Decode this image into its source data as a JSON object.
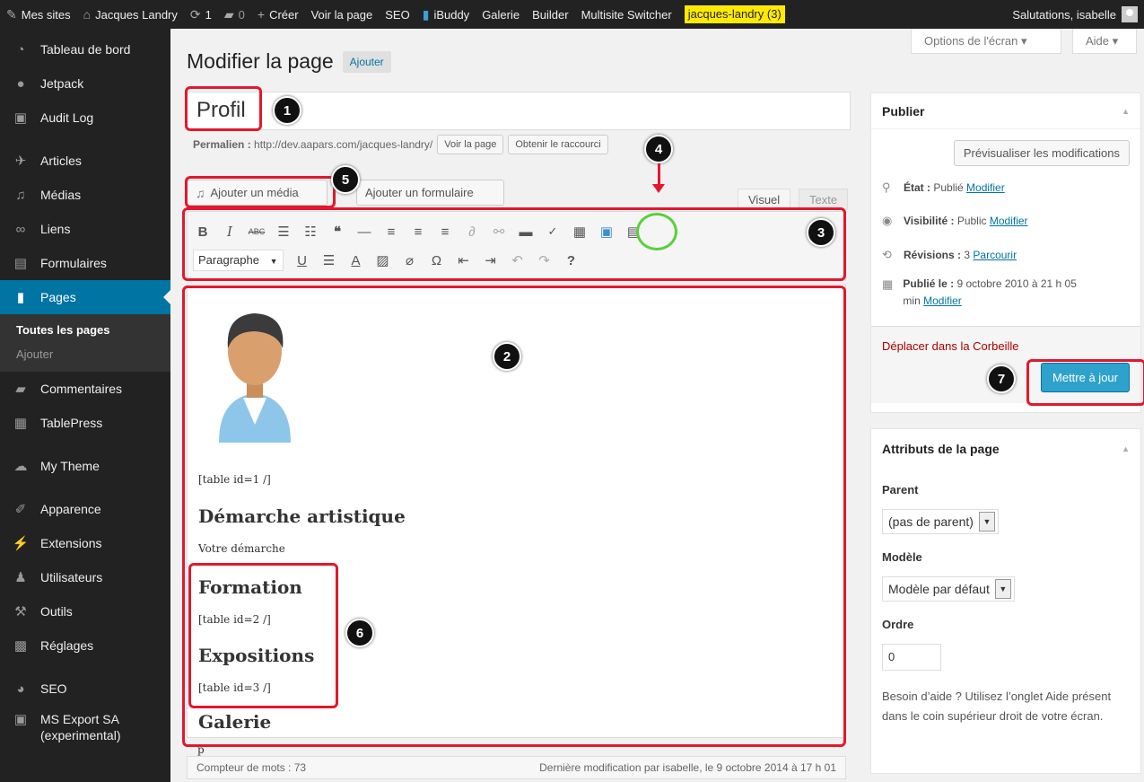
{
  "adminbar": {
    "items": [
      {
        "icon": "wp-logo-icon",
        "glyph": "✎",
        "label": "Mes sites"
      },
      {
        "icon": "home-icon",
        "glyph": "⌂",
        "label": "Jacques Landry"
      },
      {
        "icon": "updates-icon",
        "glyph": "⟳",
        "label": "1"
      },
      {
        "icon": "comments-icon",
        "glyph": "▰",
        "label": "0"
      },
      {
        "icon": "plus-icon",
        "glyph": "+",
        "label": "Créer"
      },
      {
        "icon": "",
        "glyph": "",
        "label": "Voir la page"
      },
      {
        "icon": "",
        "glyph": "",
        "label": "SEO"
      },
      {
        "icon": "ibuddy-icon",
        "glyph": "▮",
        "label": "iBuddy"
      },
      {
        "icon": "",
        "glyph": "",
        "label": "Galerie"
      },
      {
        "icon": "",
        "glyph": "",
        "label": "Builder"
      },
      {
        "icon": "",
        "glyph": "",
        "label": "Multisite Switcher"
      }
    ],
    "highlight": "jacques-landry (3)",
    "greeting": "Salutations, isabelle"
  },
  "sidebar": {
    "items": [
      {
        "icon": "dashboard-icon",
        "glyph": "◔",
        "label": "Tableau de bord"
      },
      {
        "icon": "jetpack-icon",
        "glyph": "●",
        "label": "Jetpack"
      },
      {
        "icon": "audit-log-icon",
        "glyph": "▣",
        "label": "Audit Log"
      },
      {
        "icon": "articles-icon",
        "glyph": "✈",
        "label": "Articles"
      },
      {
        "icon": "media-icon",
        "glyph": "♫",
        "label": "Médias"
      },
      {
        "icon": "links-icon",
        "glyph": "∞",
        "label": "Liens"
      },
      {
        "icon": "forms-icon",
        "glyph": "▤",
        "label": "Formulaires"
      },
      {
        "icon": "pages-icon",
        "glyph": "▮",
        "label": "Pages"
      }
    ],
    "submenu": [
      "Toutes les pages",
      "Ajouter"
    ],
    "items2": [
      {
        "icon": "comments-icon",
        "glyph": "▰",
        "label": "Commentaires"
      },
      {
        "icon": "tablepress-icon",
        "glyph": "▦",
        "label": "TablePress"
      },
      {
        "icon": "my-theme-icon",
        "glyph": "☁",
        "label": "My Theme"
      },
      {
        "icon": "appearance-icon",
        "glyph": "✐",
        "label": "Apparence"
      },
      {
        "icon": "extensions-icon",
        "glyph": "⚡",
        "label": "Extensions"
      },
      {
        "icon": "users-icon",
        "glyph": "♟",
        "label": "Utilisateurs"
      },
      {
        "icon": "tools-icon",
        "glyph": "⚒",
        "label": "Outils"
      },
      {
        "icon": "settings-icon",
        "glyph": "▩",
        "label": "Réglages"
      },
      {
        "icon": "seo-icon",
        "glyph": "◕",
        "label": "SEO"
      },
      {
        "icon": "ms-export-icon",
        "glyph": "▣",
        "label": "MS Export SA"
      }
    ],
    "ms_export_sub": "(experimental)"
  },
  "header": {
    "screen_options": "Options de l'écran ▾",
    "help": "Aide ▾",
    "title": "Modifier la page",
    "add_new": "Ajouter"
  },
  "editor": {
    "post_title": "Profil",
    "permalink_label": "Permalien :",
    "permalink_url": "http://dev.aapars.com/jacques-landry/",
    "view_page": "Voir la page",
    "shortlink": "Obtenir le raccourci",
    "add_media": "Ajouter un média",
    "add_form": "Ajouter un formulaire",
    "tab_visual": "Visuel",
    "tab_text": "Texte",
    "format_select": "Paragraphe",
    "content": {
      "shortcode1": "[table id=1 /]",
      "heading1": "Démarche artistique",
      "para1": "Votre démarche",
      "heading2": "Formation",
      "shortcode2": "[table id=2 /]",
      "heading3": "Expositions",
      "shortcode3": "[table id=3 /]",
      "heading4": "Galerie",
      "trailing": "p"
    },
    "word_count": "Compteur de mots : 73",
    "last_modified": "Dernière modification par isabelle, le 9 octobre 2014 à 17 h 01"
  },
  "publish": {
    "title": "Publier",
    "preview": "Prévisualiser les modifications",
    "status_label": "État :",
    "status_value": "Publié",
    "visibility_label": "Visibilité :",
    "visibility_value": "Public",
    "revisions_label": "Révisions :",
    "revisions_value": "3",
    "browse": "Parcourir",
    "published_label": "Publié le :",
    "published_value": "9 octobre 2010 à 21 h 05 min",
    "modify": "Modifier",
    "trash": "Déplacer dans la Corbeille",
    "update": "Mettre à jour"
  },
  "attributes": {
    "title": "Attributs de la page",
    "parent_label": "Parent",
    "parent_value": "(pas de parent)",
    "template_label": "Modèle",
    "template_value": "Modèle par défaut",
    "order_label": "Ordre",
    "order_value": "0",
    "help": "Besoin d’aide ? Utilisez l’onglet Aide présent dans le coin supérieur droit de votre écran."
  },
  "markers": [
    "1",
    "2",
    "3",
    "4",
    "5",
    "6",
    "7"
  ],
  "colors": {
    "accent": "#0074a2",
    "highlight": "#e3172d",
    "green_ring": "#5ad03a",
    "update_button": "#2ea2cc"
  }
}
